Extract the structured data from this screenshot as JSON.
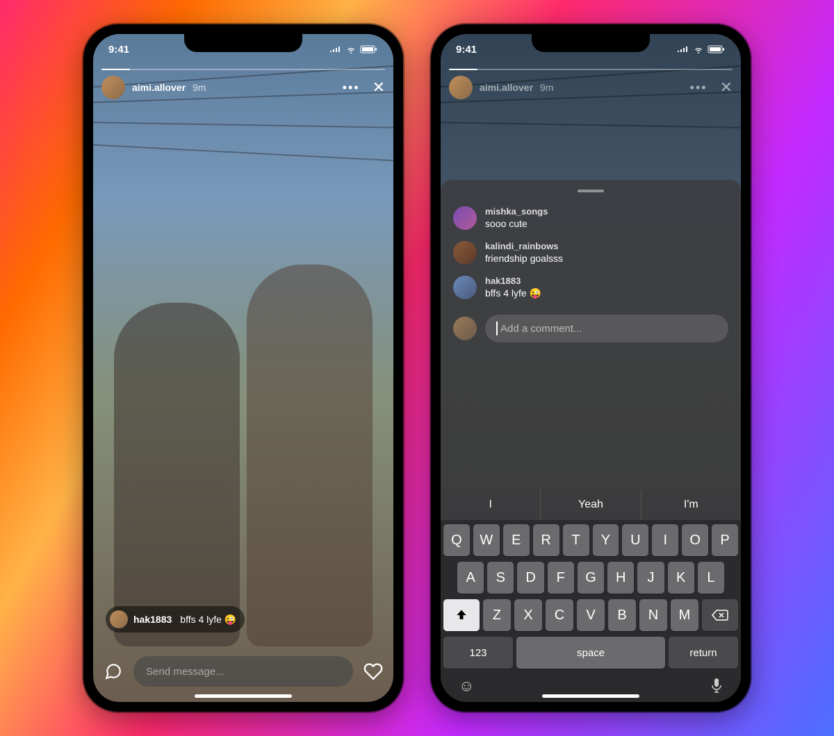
{
  "statusbar": {
    "time": "9:41"
  },
  "story": {
    "username": "aimi.allover",
    "timestamp": "9m",
    "footer_comment": {
      "user": "hak1883",
      "text": "bffs 4 lyfe 😜"
    },
    "message_placeholder": "Send message..."
  },
  "sheet": {
    "comments": [
      {
        "user": "mishka_songs",
        "text": "sooo cute"
      },
      {
        "user": "kalindi_rainbows",
        "text": "friendship goalsss"
      },
      {
        "user": "hak1883",
        "text": "bffs 4 lyfe 😜"
      }
    ],
    "input_placeholder": "Add a comment..."
  },
  "keyboard": {
    "suggestions": [
      "I",
      "Yeah",
      "I'm"
    ],
    "row1": [
      "Q",
      "W",
      "E",
      "R",
      "T",
      "Y",
      "U",
      "I",
      "O",
      "P"
    ],
    "row2": [
      "A",
      "S",
      "D",
      "F",
      "G",
      "H",
      "J",
      "K",
      "L"
    ],
    "row3": [
      "Z",
      "X",
      "C",
      "V",
      "B",
      "N",
      "M"
    ],
    "num_key": "123",
    "space_key": "space",
    "return_key": "return"
  }
}
